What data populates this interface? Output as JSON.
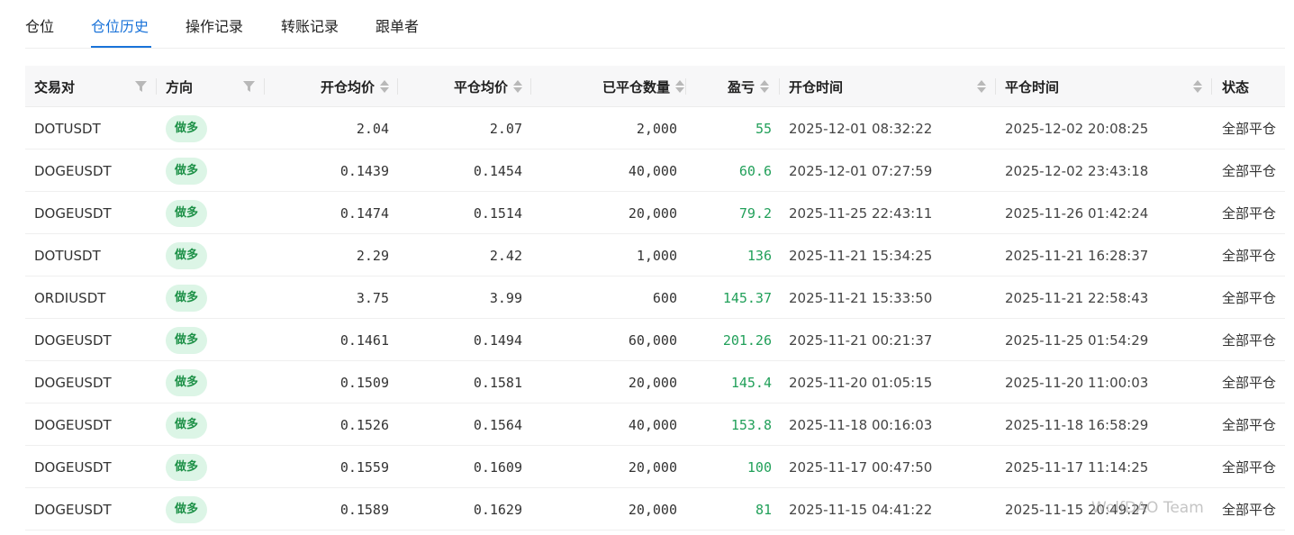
{
  "tabs": [
    {
      "label": "仓位"
    },
    {
      "label": "仓位历史"
    },
    {
      "label": "操作记录"
    },
    {
      "label": "转账记录"
    },
    {
      "label": "跟单者"
    }
  ],
  "active_tab": "仓位历史",
  "columns": {
    "pair": "交易对",
    "direction": "方向",
    "open_price": "开仓均价",
    "close_price": "平仓均价",
    "closed_qty": "已平仓数量",
    "pnl": "盈亏",
    "open_time": "开仓时间",
    "close_time": "平仓时间",
    "status": "状态"
  },
  "rows": [
    {
      "pair": "DOTUSDT",
      "direction": "做多",
      "open_price": "2.04",
      "close_price": "2.07",
      "closed_qty": "2,000",
      "pnl": "55",
      "open_time": "2025-12-01 08:32:22",
      "close_time": "2025-12-02 20:08:25",
      "status": "全部平仓"
    },
    {
      "pair": "DOGEUSDT",
      "direction": "做多",
      "open_price": "0.1439",
      "close_price": "0.1454",
      "closed_qty": "40,000",
      "pnl": "60.6",
      "open_time": "2025-12-01 07:27:59",
      "close_time": "2025-12-02 23:43:18",
      "status": "全部平仓"
    },
    {
      "pair": "DOGEUSDT",
      "direction": "做多",
      "open_price": "0.1474",
      "close_price": "0.1514",
      "closed_qty": "20,000",
      "pnl": "79.2",
      "open_time": "2025-11-25 22:43:11",
      "close_time": "2025-11-26 01:42:24",
      "status": "全部平仓"
    },
    {
      "pair": "DOTUSDT",
      "direction": "做多",
      "open_price": "2.29",
      "close_price": "2.42",
      "closed_qty": "1,000",
      "pnl": "136",
      "open_time": "2025-11-21 15:34:25",
      "close_time": "2025-11-21 16:28:37",
      "status": "全部平仓"
    },
    {
      "pair": "ORDIUSDT",
      "direction": "做多",
      "open_price": "3.75",
      "close_price": "3.99",
      "closed_qty": "600",
      "pnl": "145.37",
      "open_time": "2025-11-21 15:33:50",
      "close_time": "2025-11-21 22:58:43",
      "status": "全部平仓"
    },
    {
      "pair": "DOGEUSDT",
      "direction": "做多",
      "open_price": "0.1461",
      "close_price": "0.1494",
      "closed_qty": "60,000",
      "pnl": "201.26",
      "open_time": "2025-11-21 00:21:37",
      "close_time": "2025-11-25 01:54:29",
      "status": "全部平仓"
    },
    {
      "pair": "DOGEUSDT",
      "direction": "做多",
      "open_price": "0.1509",
      "close_price": "0.1581",
      "closed_qty": "20,000",
      "pnl": "145.4",
      "open_time": "2025-11-20 01:05:15",
      "close_time": "2025-11-20 11:00:03",
      "status": "全部平仓"
    },
    {
      "pair": "DOGEUSDT",
      "direction": "做多",
      "open_price": "0.1526",
      "close_price": "0.1564",
      "closed_qty": "40,000",
      "pnl": "153.8",
      "open_time": "2025-11-18 00:16:03",
      "close_time": "2025-11-18 16:58:29",
      "status": "全部平仓"
    },
    {
      "pair": "DOGEUSDT",
      "direction": "做多",
      "open_price": "0.1559",
      "close_price": "0.1609",
      "closed_qty": "20,000",
      "pnl": "100",
      "open_time": "2025-11-17 00:47:50",
      "close_time": "2025-11-17 11:14:25",
      "status": "全部平仓"
    },
    {
      "pair": "DOGEUSDT",
      "direction": "做多",
      "open_price": "0.1589",
      "close_price": "0.1629",
      "closed_qty": "20,000",
      "pnl": "81",
      "open_time": "2025-11-15 04:41:22",
      "close_time": "2025-11-15 20:49:27",
      "status": "全部平仓"
    }
  ],
  "watermark": "WolfDAO Team",
  "colors": {
    "accent": "#1a73d9",
    "profit": "#22a05a",
    "badge_bg": "#dcf5e6",
    "badge_text": "#1e9148",
    "header_bg": "#f7f7f8"
  }
}
